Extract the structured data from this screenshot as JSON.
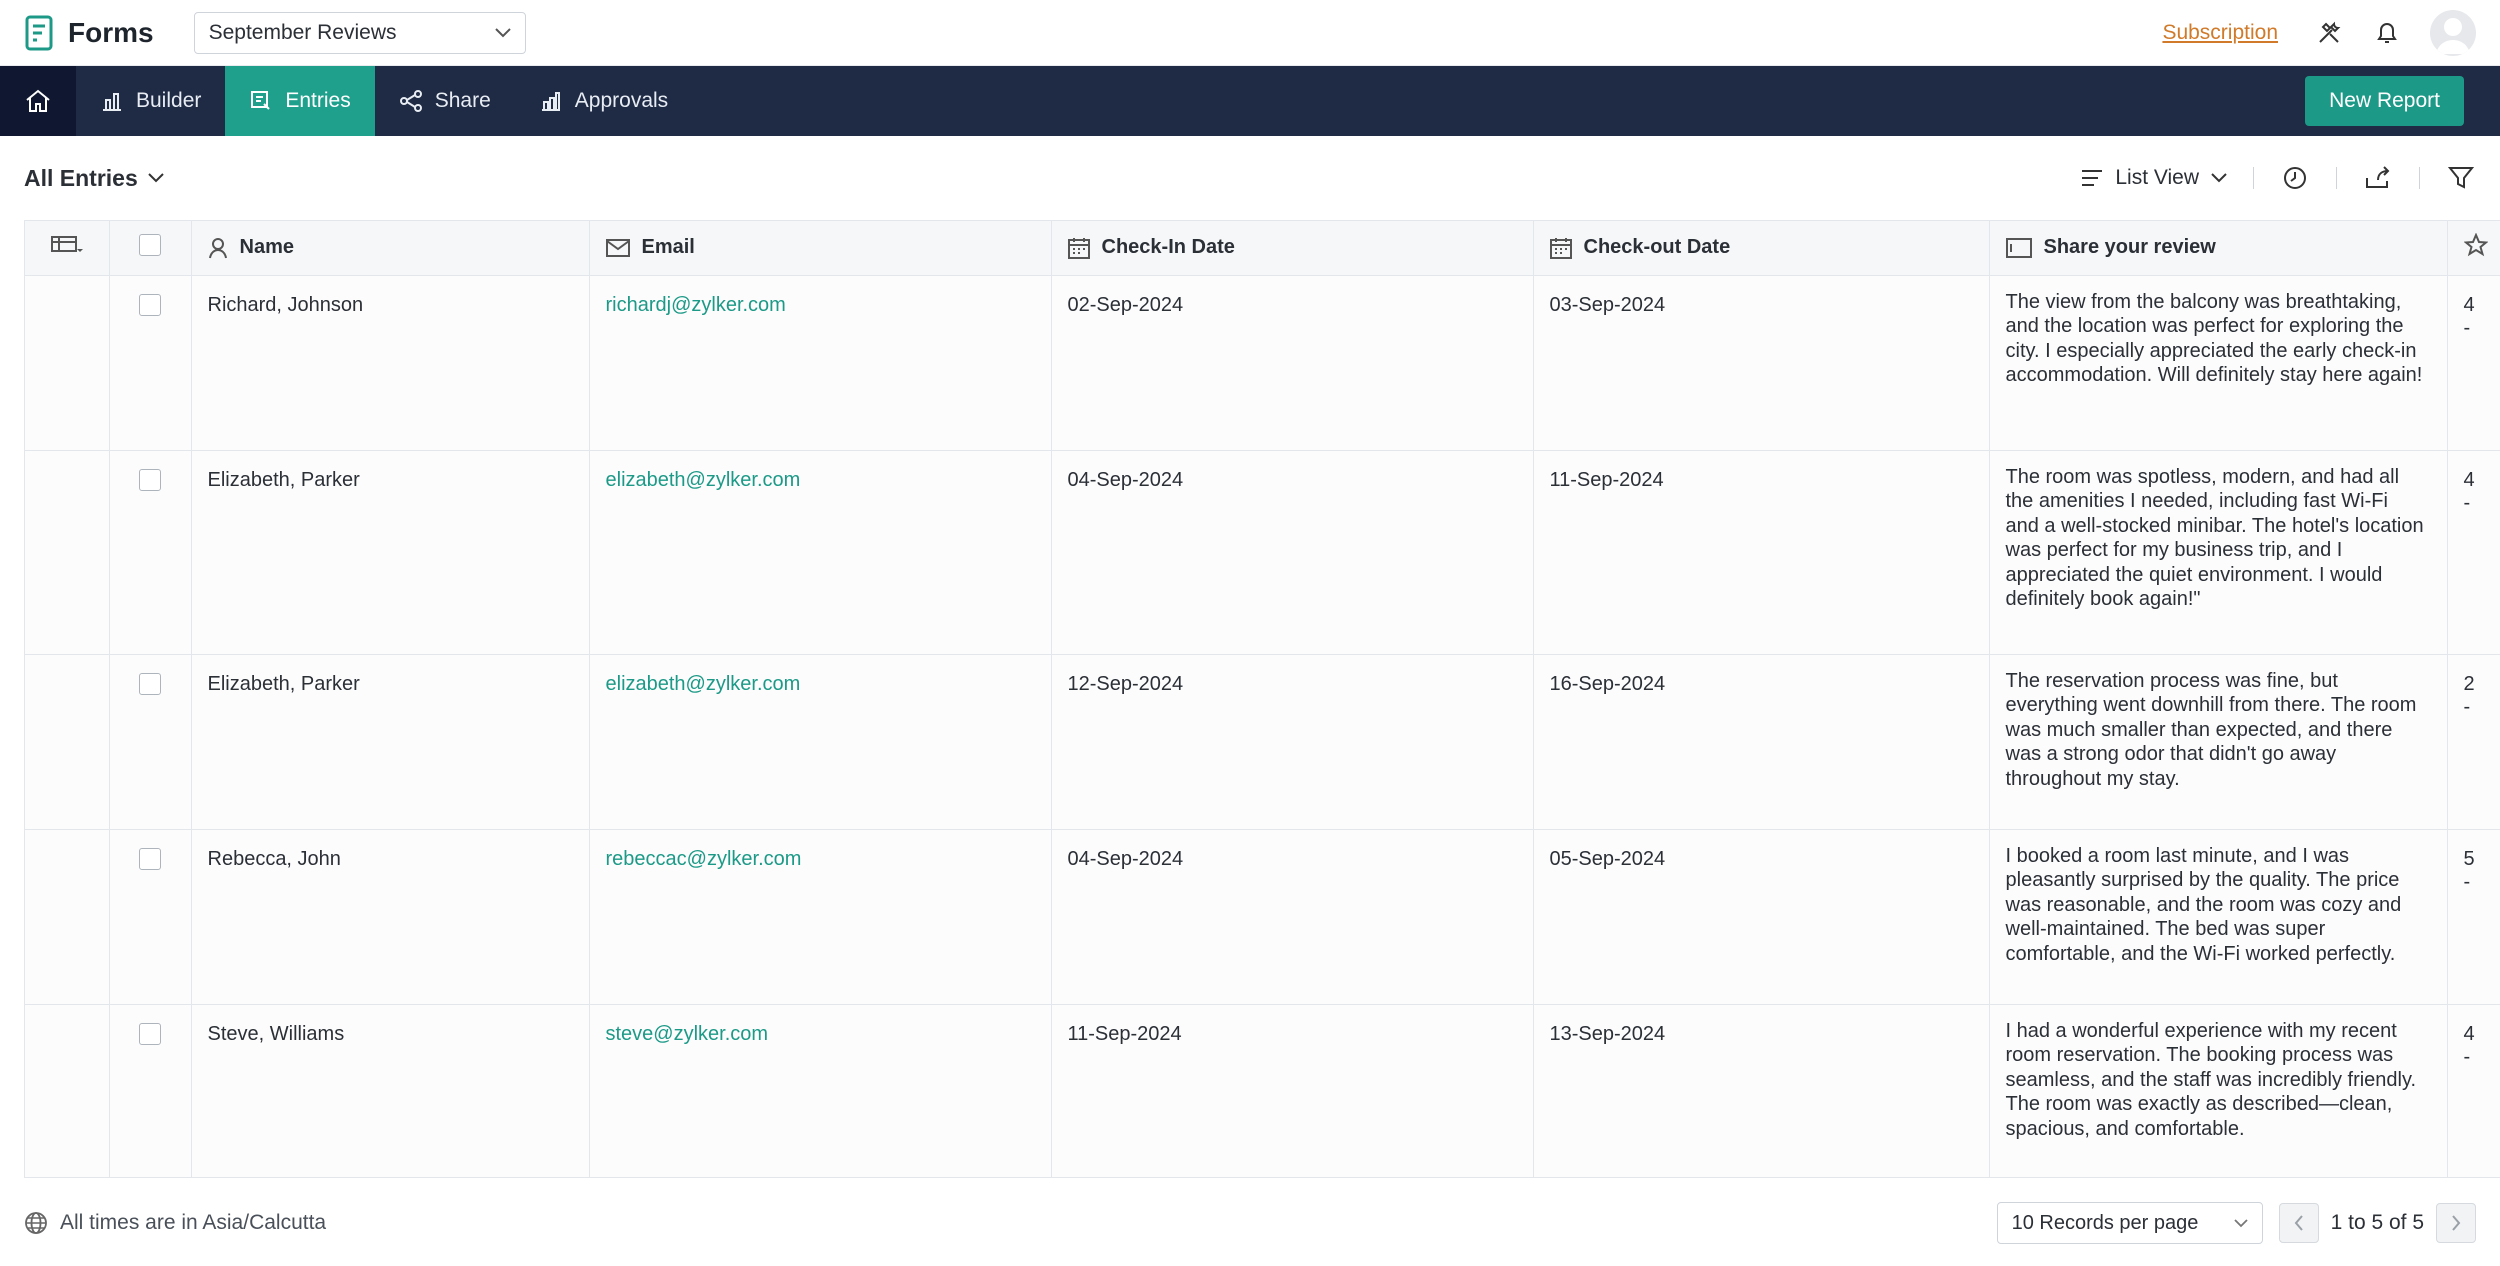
{
  "app": {
    "name": "Forms",
    "selected_form": "September Reviews",
    "subscription_link": "Subscription"
  },
  "nav": {
    "items": [
      {
        "label": "Builder",
        "icon": "builder-icon"
      },
      {
        "label": "Entries",
        "icon": "entries-icon",
        "active": true
      },
      {
        "label": "Share",
        "icon": "share-icon"
      },
      {
        "label": "Approvals",
        "icon": "approvals-icon"
      }
    ],
    "new_report": "New Report"
  },
  "toolbar": {
    "filter_label": "All Entries",
    "view_label": "List View"
  },
  "table": {
    "columns": {
      "name": "Name",
      "email": "Email",
      "checkin": "Check-In Date",
      "checkout": "Check-out Date",
      "review": "Share your review"
    },
    "rows": [
      {
        "name": "Richard, Johnson",
        "email": "richardj@zylker.com",
        "checkin": "02-Sep-2024",
        "checkout": "03-Sep-2024",
        "review": "The view from the balcony was breathtaking, and the location was perfect for exploring the city. I especially appreciated the early check-in accommodation. Will definitely stay here again!",
        "rating": "4 -"
      },
      {
        "name": "Elizabeth, Parker",
        "email": "elizabeth@zylker.com",
        "checkin": "04-Sep-2024",
        "checkout": "11-Sep-2024",
        "review": "The room was spotless, modern, and had all the amenities I needed, including fast Wi-Fi and a well-stocked minibar. The hotel's location was perfect for my business trip, and I appreciated the quiet environment. I would definitely book again!\"",
        "rating": "4 -"
      },
      {
        "name": "Elizabeth, Parker",
        "email": "elizabeth@zylker.com",
        "checkin": "12-Sep-2024",
        "checkout": "16-Sep-2024",
        "review": "The reservation process was fine, but everything went downhill from there. The room was much smaller than expected, and there was a strong odor that didn't go away throughout my stay.",
        "rating": "2 -"
      },
      {
        "name": "Rebecca, John",
        "email": "rebeccac@zylker.com",
        "checkin": "04-Sep-2024",
        "checkout": "05-Sep-2024",
        "review": "I booked a room last minute, and I was pleasantly surprised by the quality. The price was reasonable, and the room was cozy and well-maintained. The bed was super comfortable, and the Wi-Fi worked perfectly.",
        "rating": "5 -"
      },
      {
        "name": "Steve, Williams",
        "email": "steve@zylker.com",
        "checkin": "11-Sep-2024",
        "checkout": "13-Sep-2024",
        "review": "I had a wonderful experience with my recent room reservation. The booking process was seamless, and the staff was incredibly friendly. The room was exactly as described—clean, spacious, and comfortable.",
        "rating": "4 -"
      }
    ]
  },
  "footer": {
    "timezone": "All times are in Asia/Calcutta",
    "per_page": "10 Records per page",
    "range": "1 to 5 of 5"
  },
  "colors": {
    "nav_background": "#1f2b45",
    "accent": "#1c9a87",
    "subscription": "#d07a2a"
  }
}
